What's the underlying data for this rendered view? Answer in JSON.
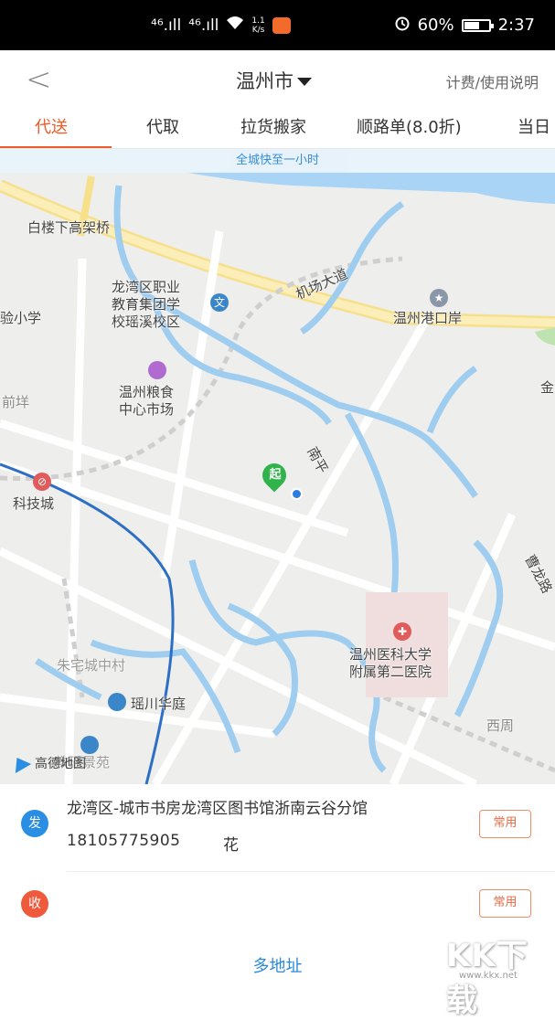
{
  "status_bar": {
    "signal1": "⁴⁶.ıll",
    "signal2": "⁴⁶.ıll",
    "speed_value": "1.1",
    "speed_unit": "K/s",
    "battery_percent": "60%",
    "time": "2:37"
  },
  "header": {
    "back_glyph": "<",
    "city": "温州市",
    "help_link": "计费/使用说明"
  },
  "tabs": [
    {
      "label": "代送",
      "active": true
    },
    {
      "label": "代取",
      "active": false
    },
    {
      "label": "拉货搬家",
      "active": false
    },
    {
      "label": "顺路单(8.0折)",
      "active": false
    },
    {
      "label": "当日",
      "active": false
    }
  ],
  "map": {
    "banner": "全城快至一小时",
    "start_pin_label": "起",
    "labels": {
      "bridge": "白楼下高架桥",
      "school": "龙湾区职业\n教育集团学\n校瑶溪校区",
      "school_line1": "龙湾区职业",
      "school_line2": "教育集团学",
      "school_line3": "校瑶溪校区",
      "airport_road": "机场大道",
      "port": "温州港口岸",
      "grain1": "温州粮食",
      "grain2": "中心市场",
      "primary_school": "验小学",
      "qianhuan": "前垟",
      "tech_city": "科技城",
      "nan_road": "南平",
      "caolong_road": "曹龙路",
      "hospital1": "温州医科大学",
      "hospital2": "附属第二医院",
      "zhuzhai": "朱宅城中村",
      "yaochuan": "瑶川华庭",
      "xizhou": "西周",
      "jin": "金",
      "amap": "高德地图",
      "yaojin": "教瑶景苑"
    },
    "icons": {
      "school_icon": "文",
      "hospital_icon": "✚",
      "port_icon": "★",
      "metro_icon": "⊘"
    }
  },
  "sender": {
    "badge": "发",
    "address": "龙湾区-城市书房龙湾区图书馆浙南云谷分馆",
    "phone": "18105775905",
    "name": "花",
    "common_button": "常用"
  },
  "receiver": {
    "badge": "收",
    "common_button": "常用"
  },
  "multi_address": "多地址",
  "watermark": {
    "main": "KK下载",
    "sub": "www.kkx.net"
  },
  "colors": {
    "accent": "#f05a28",
    "link_blue": "#2b89d8",
    "send_badge": "#2a8ee4",
    "recv_badge": "#ee5a3b",
    "pin_green": "#2fb34a",
    "water": "#a9d4f5",
    "main_road": "#f7e7a0"
  }
}
